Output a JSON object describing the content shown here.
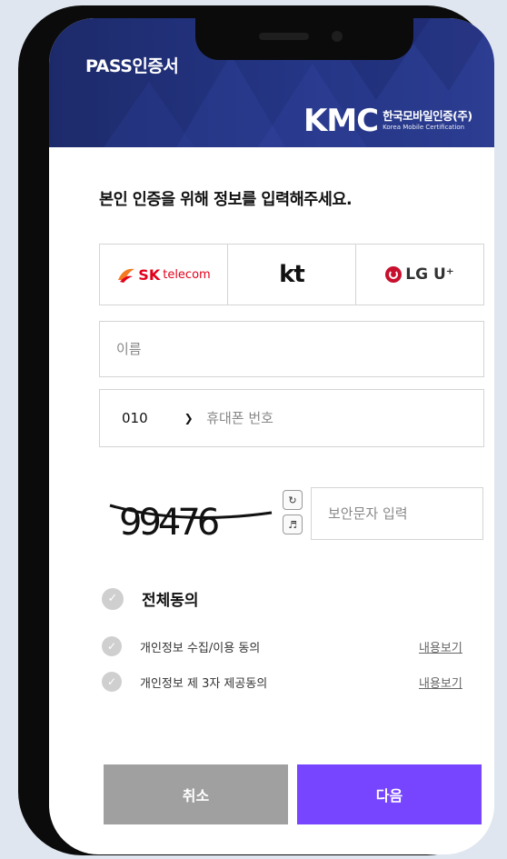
{
  "header": {
    "title": "PASS인증서",
    "brand_mark": "KMC",
    "brand_name_ko": "한국모바일인증(주)",
    "brand_name_en": "Korea Mobile Certification",
    "background_color": "#243585"
  },
  "heading": "본인 인증을 위해 정보를 입력해주세요.",
  "carriers": [
    {
      "name_main": "SK",
      "name_sub": "telecom",
      "color": "#e3001b"
    },
    {
      "name_main": "kt",
      "color": "#111111"
    },
    {
      "name_main": "LG U⁺",
      "color": "#c8102e"
    }
  ],
  "form": {
    "name_placeholder": "이름",
    "phone_prefix": "010",
    "phone_placeholder": "휴대폰 번호",
    "captcha_text": "99476",
    "captcha_placeholder": "보안문자 입력"
  },
  "agreements": {
    "all_label": "전체동의",
    "items": [
      {
        "label": "개인정보 수집/이용 동의",
        "link": "내용보기"
      },
      {
        "label": "개인정보 제 3자 제공동의",
        "link": "내용보기"
      }
    ]
  },
  "buttons": {
    "cancel": "취소",
    "next": "다음",
    "next_color": "#7744ff",
    "cancel_color": "#a0a0a0"
  }
}
